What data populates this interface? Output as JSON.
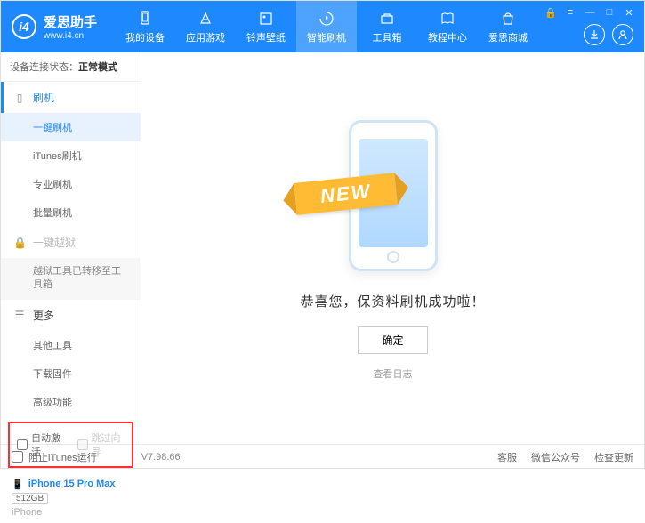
{
  "header": {
    "logo_text": "爱思助手",
    "logo_sub": "www.i4.cn",
    "nav": [
      {
        "label": "我的设备"
      },
      {
        "label": "应用游戏"
      },
      {
        "label": "铃声壁纸"
      },
      {
        "label": "智能刷机"
      },
      {
        "label": "工具箱"
      },
      {
        "label": "教程中心"
      },
      {
        "label": "爱思商城"
      }
    ]
  },
  "status": {
    "label": "设备连接状态：",
    "value": "正常模式"
  },
  "sidebar": {
    "flash": {
      "head": "刷机",
      "items": [
        "一键刷机",
        "iTunes刷机",
        "专业刷机",
        "批量刷机"
      ]
    },
    "jailbreak": {
      "head": "一键越狱",
      "note": "越狱工具已转移至工具箱"
    },
    "more": {
      "head": "更多",
      "items": [
        "其他工具",
        "下载固件",
        "高级功能"
      ]
    },
    "checkboxes": {
      "auto_activate": "自动激活",
      "skip_setup": "跳过向导"
    },
    "device": {
      "name": "iPhone 15 Pro Max",
      "capacity": "512GB",
      "type": "iPhone"
    }
  },
  "main": {
    "ribbon": "NEW",
    "success": "恭喜您，保资料刷机成功啦！",
    "confirm": "确定",
    "view_log": "查看日志"
  },
  "footer": {
    "block_itunes": "阻止iTunes运行",
    "version": "V7.98.66",
    "links": [
      "客服",
      "微信公众号",
      "检查更新"
    ]
  }
}
